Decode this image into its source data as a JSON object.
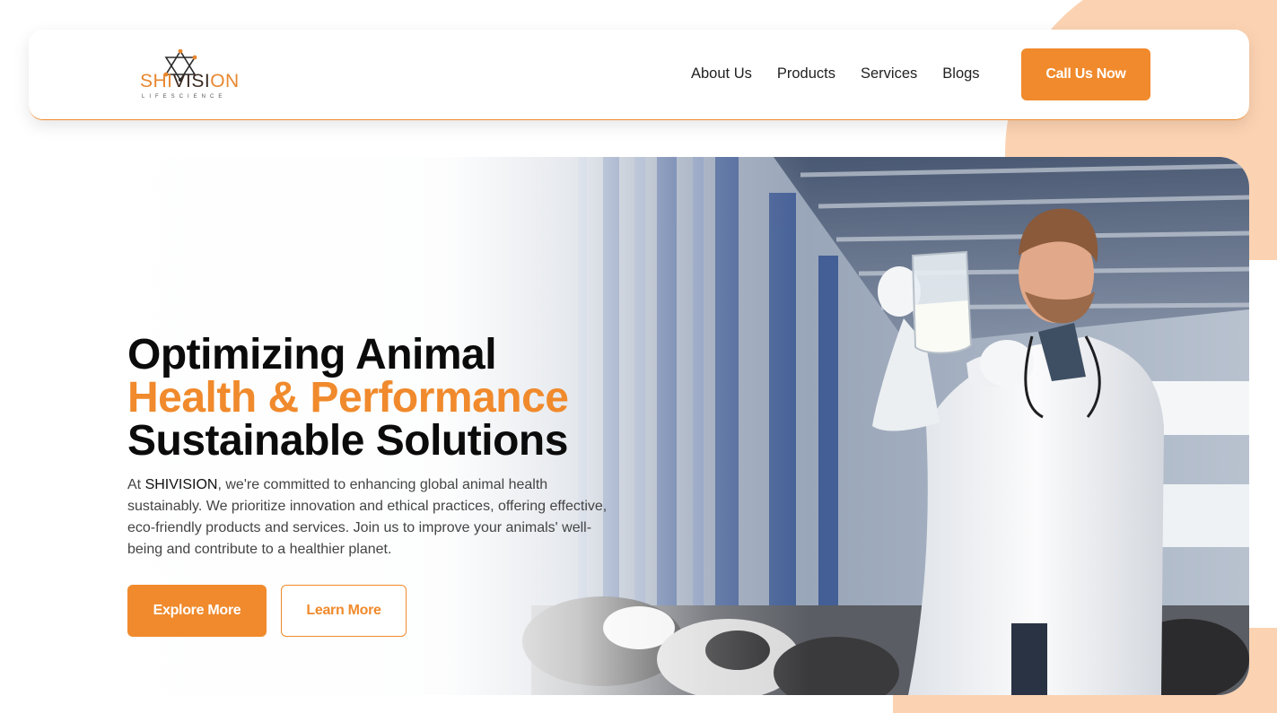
{
  "header": {
    "logo": {
      "word": "SHIVISION",
      "word_prefix": "SHI",
      "word_middle": "VISI",
      "word_o": "O",
      "word_suffix": "N",
      "tagline": "LIFESCIENCE"
    },
    "nav": [
      "About Us",
      "Products",
      "Services",
      "Blogs"
    ],
    "cta_label": "Call Us Now"
  },
  "hero": {
    "headline_line1": "Optimizing Animal",
    "headline_line2": "Health & Performance",
    "headline_line3": "Sustainable Solutions",
    "intro_prefix": "At ",
    "intro_brand": "SHIVISION",
    "intro_rest": ", we're committed to enhancing global animal health sustainably. We prioritize innovation and ethical practices, offering effective, eco-friendly products and services. Join us to improve your animals' well-being and contribute to a healthier planet.",
    "primary_button": "Explore More",
    "secondary_button": "Learn More"
  },
  "colors": {
    "accent": "#f08a2c",
    "peach": "#fcd3b2",
    "text_dark": "#0b0b0b",
    "text_body": "#444444"
  },
  "icons": {
    "logo_mark": "star-of-david-network-icon",
    "hero_image": "veterinarian-with-milk-jug-photo"
  }
}
